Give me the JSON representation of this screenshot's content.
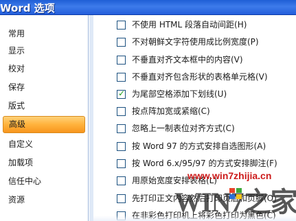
{
  "window": {
    "title": "Word 选项"
  },
  "sidebar": {
    "items": [
      {
        "label": "常用"
      },
      {
        "label": "显示"
      },
      {
        "label": "校对"
      },
      {
        "label": "保存"
      },
      {
        "label": "版式"
      },
      {
        "label": "高级",
        "active": true
      },
      {
        "label": "自定义"
      },
      {
        "label": "加载项"
      },
      {
        "label": "信任中心"
      },
      {
        "label": "资源"
      }
    ]
  },
  "options": [
    {
      "label": "不使用 HTML 段落自动间距(H)",
      "checked": false
    },
    {
      "label": "不对朝鲜文字符使用成比例宽度(P)",
      "checked": false
    },
    {
      "label": "不垂直对齐文本框中的内容(V)",
      "checked": false
    },
    {
      "label": "不垂直对齐包含形状的表格单元格(V)",
      "checked": false
    },
    {
      "label": "为尾部空格添加下划线(U)",
      "checked": true
    },
    {
      "label": "按点阵加宽或紧缩(C)",
      "checked": false
    },
    {
      "label": "忽略上一制表位对齐方式(C)",
      "checked": false
    },
    {
      "label": "按 Word 97 的方式安排自选图形(A)",
      "checked": false
    },
    {
      "label": "按 Word 6.x/95/97 的方式安排脚注(F)",
      "checked": false
    },
    {
      "label": "用原始宽度安排表格(L)",
      "checked": false
    },
    {
      "label": "先打印正文内容然后打印页眉和页脚(O)",
      "checked": false
    },
    {
      "label": "在非彩色打印机上将彩色打印为黑色(C)",
      "checked": false
    }
  ],
  "watermark": {
    "url": "www.win7zhijia.cn",
    "brand": "WIN7之家"
  },
  "colors": {
    "titlebar": "#245edb",
    "active_nav": "#ffb23c",
    "checkbox_border": "#1c5180",
    "checkmark": "#21a121",
    "watermark_url": "#cc1a1a"
  }
}
